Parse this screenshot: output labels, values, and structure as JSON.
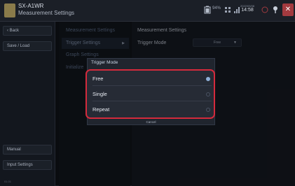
{
  "header": {
    "device": "SX-A1WR",
    "subtitle": "Measurement Settings",
    "battery": "94%",
    "date": "2022/03/08",
    "time": "14:58"
  },
  "sidebar": {
    "back_label": "Back",
    "save_load_label": "Save / Load",
    "manual_label": "Manual",
    "input_settings_label": "Input Settings",
    "version": "01.01"
  },
  "menu": {
    "items": [
      {
        "label": "Measurement Settings"
      },
      {
        "label": "Trigger Settings"
      },
      {
        "label": "Graph Settings"
      },
      {
        "label": "Initialize"
      }
    ]
  },
  "panel": {
    "title": "Measurement Settings",
    "trigger_label": "Trigger Mode",
    "trigger_value": "Free"
  },
  "dialog": {
    "title": "Trigger Mode",
    "options": [
      {
        "label": "Free",
        "selected": true
      },
      {
        "label": "Single",
        "selected": false
      },
      {
        "label": "Repeat",
        "selected": false
      }
    ],
    "cancel_label": "Cancel"
  },
  "colors": {
    "highlight": "#d42a3c",
    "close": "#a23a3f",
    "accent": "#8fb0d8"
  }
}
